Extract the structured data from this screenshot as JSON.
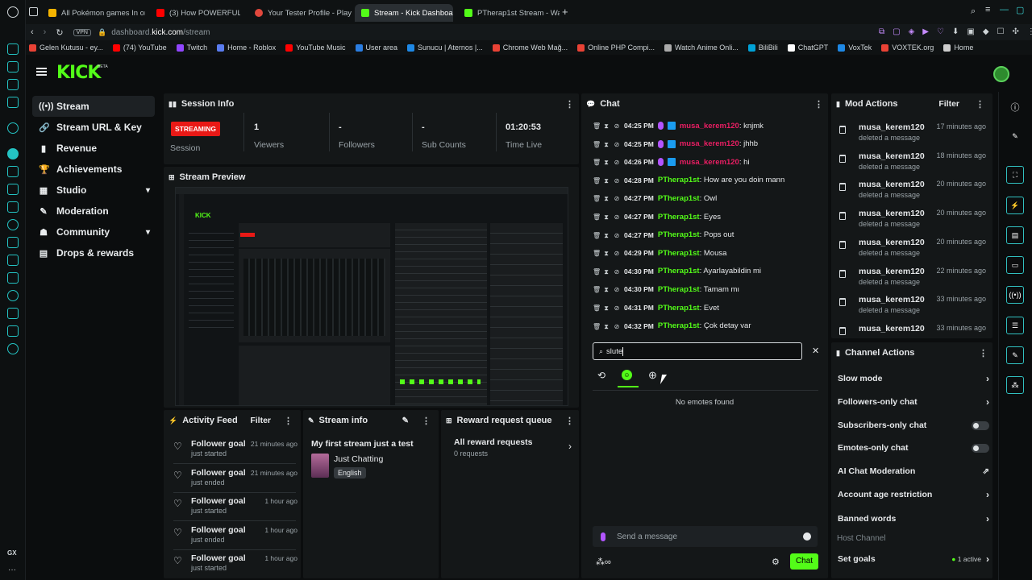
{
  "tabs": [
    {
      "label": "All Pokémon games In ord",
      "color": "#f5b400"
    },
    {
      "label": "(3) How POWERFUL Can",
      "color": "#ff0000"
    },
    {
      "label": "Your Tester Profile - Playt",
      "color": "#e2483d"
    },
    {
      "label": "Stream - Kick Dashboa",
      "color": "#53fc18"
    },
    {
      "label": "PTherap1st Stream - Watc",
      "color": "#53fc18"
    }
  ],
  "url": {
    "prefix": "dashboard.",
    "domain": "kick.com",
    "path": "/stream",
    "vpn": "VPN"
  },
  "bookmarks": [
    {
      "label": "Gelen Kutusu - ey...",
      "color": "#e94235"
    },
    {
      "label": "(74) YouTube",
      "color": "#ff0000"
    },
    {
      "label": "Twitch",
      "color": "#9146ff"
    },
    {
      "label": "Home - Roblox",
      "color": "#5a7cf0"
    },
    {
      "label": "YouTube Music",
      "color": "#ff0000"
    },
    {
      "label": "User area",
      "color": "#2a7de1"
    },
    {
      "label": "Sunucu | Aternos |...",
      "color": "#1e88e5"
    },
    {
      "label": "Chrome Web Mağ...",
      "color": "#e94235"
    },
    {
      "label": "Online PHP Compi...",
      "color": "#e94235"
    },
    {
      "label": "Watch Anime Onli...",
      "color": "#aaaaaa"
    },
    {
      "label": "BiliBili",
      "color": "#00a1d6"
    },
    {
      "label": "ChatGPT",
      "color": "#ffffff"
    },
    {
      "label": "VoxTek",
      "color": "#1e88e5"
    },
    {
      "label": "VOXTEK.org",
      "color": "#e94235"
    },
    {
      "label": "Home",
      "color": "#cccccc"
    }
  ],
  "brand": {
    "logo": "KICK",
    "beta": "BETA",
    "accent": "#53fc18"
  },
  "nav": [
    {
      "label": "Stream",
      "icon": "((•))"
    },
    {
      "label": "Stream URL & Key",
      "icon": "🔗"
    },
    {
      "label": "Revenue",
      "icon": "▮"
    },
    {
      "label": "Achievements",
      "icon": "🏆"
    },
    {
      "label": "Studio",
      "icon": "▦",
      "chevron": "▾"
    },
    {
      "label": "Moderation",
      "icon": "✎"
    },
    {
      "label": "Community",
      "icon": "☗",
      "chevron": "▾"
    },
    {
      "label": "Drops & rewards",
      "icon": "▤"
    }
  ],
  "session": {
    "title": "Session Info",
    "status": "STREAMING",
    "status_label": "Session",
    "stats": [
      {
        "value": "1",
        "label": "Viewers"
      },
      {
        "value": "-",
        "label": "Followers"
      },
      {
        "value": "-",
        "label": "Sub Counts"
      },
      {
        "value": "01:20:53",
        "label": "Time Live"
      }
    ]
  },
  "preview": {
    "title": "Stream Preview"
  },
  "activity": {
    "title": "Activity Feed",
    "filter": "Filter",
    "items": [
      {
        "title": "Follower goal",
        "status": "just started",
        "when": "21 minutes ago"
      },
      {
        "title": "Follower goal",
        "status": "just ended",
        "when": "21 minutes ago"
      },
      {
        "title": "Follower goal",
        "status": "just started",
        "when": "1 hour ago"
      },
      {
        "title": "Follower goal",
        "status": "just ended",
        "when": "1 hour ago"
      },
      {
        "title": "Follower goal",
        "status": "just started",
        "when": "1 hour ago"
      }
    ]
  },
  "streaminfo": {
    "title": "Stream info",
    "stream_title": "My first stream just a test",
    "category": "Just Chatting",
    "language": "English"
  },
  "reward": {
    "title": "Reward request queue",
    "all": "All reward requests",
    "count": "0 requests"
  },
  "chat": {
    "title": "Chat",
    "messages": [
      {
        "time": "04:25 PM",
        "user": "musa_kerem120",
        "text": ": knjmk",
        "mod": false
      },
      {
        "time": "04:25 PM",
        "user": "musa_kerem120",
        "text": ": jhhb",
        "mod": false
      },
      {
        "time": "04:26 PM",
        "user": "musa_kerem120",
        "text": ": hi",
        "mod": false
      },
      {
        "time": "04:28 PM",
        "user": "PTherap1st",
        "text": ": How are you doin mann",
        "mod": true
      },
      {
        "time": "04:27 PM",
        "user": "PTherap1st",
        "text": ": Owl",
        "mod": true
      },
      {
        "time": "04:27 PM",
        "user": "PTherap1st",
        "text": ": Eyes",
        "mod": true
      },
      {
        "time": "04:27 PM",
        "user": "PTherap1st",
        "text": ": Pops out",
        "mod": true
      },
      {
        "time": "04:29 PM",
        "user": "PTherap1st",
        "text": ": Mousa",
        "mod": true
      },
      {
        "time": "04:30 PM",
        "user": "PTherap1st",
        "text": ": Ayarlayabildin mi",
        "mod": true
      },
      {
        "time": "04:30 PM",
        "user": "PTherap1st",
        "text": ": Tamam mı",
        "mod": true
      },
      {
        "time": "04:31 PM",
        "user": "PTherap1st",
        "text": ": Evet",
        "mod": true
      },
      {
        "time": "04:32 PM",
        "user": "PTherap1st",
        "text": ": Çok detay var",
        "mod": true
      }
    ],
    "emote_search": "slute",
    "no_emotes": "No emotes found",
    "placeholder": "Send a message",
    "send": "Chat"
  },
  "mod_actions": {
    "title": "Mod Actions",
    "filter": "Filter",
    "items": [
      {
        "user": "musa_kerem120",
        "action": "deleted a message",
        "when": "17 minutes ago"
      },
      {
        "user": "musa_kerem120",
        "action": "deleted a message",
        "when": "18 minutes ago"
      },
      {
        "user": "musa_kerem120",
        "action": "deleted a message",
        "when": "20 minutes ago"
      },
      {
        "user": "musa_kerem120",
        "action": "deleted a message",
        "when": "20 minutes ago"
      },
      {
        "user": "musa_kerem120",
        "action": "deleted a message",
        "when": "20 minutes ago"
      },
      {
        "user": "musa_kerem120",
        "action": "deleted a message",
        "when": "22 minutes ago"
      },
      {
        "user": "musa_kerem120",
        "action": "deleted a message",
        "when": "33 minutes ago"
      },
      {
        "user": "musa_kerem120",
        "action": "",
        "when": "33 minutes ago"
      }
    ]
  },
  "channel_actions": {
    "title": "Channel Actions",
    "items": [
      {
        "label": "Slow mode",
        "kind": "arrow"
      },
      {
        "label": "Followers-only chat",
        "kind": "arrow"
      },
      {
        "label": "Subscribers-only chat",
        "kind": "toggle"
      },
      {
        "label": "Emotes-only chat",
        "kind": "toggle"
      },
      {
        "label": "AI Chat Moderation",
        "kind": "external"
      },
      {
        "label": "Account age restriction",
        "kind": "arrow"
      },
      {
        "label": "Banned words",
        "kind": "arrow"
      }
    ],
    "host_channel": "Host Channel",
    "set_goals": "Set goals",
    "active": "1 active"
  }
}
